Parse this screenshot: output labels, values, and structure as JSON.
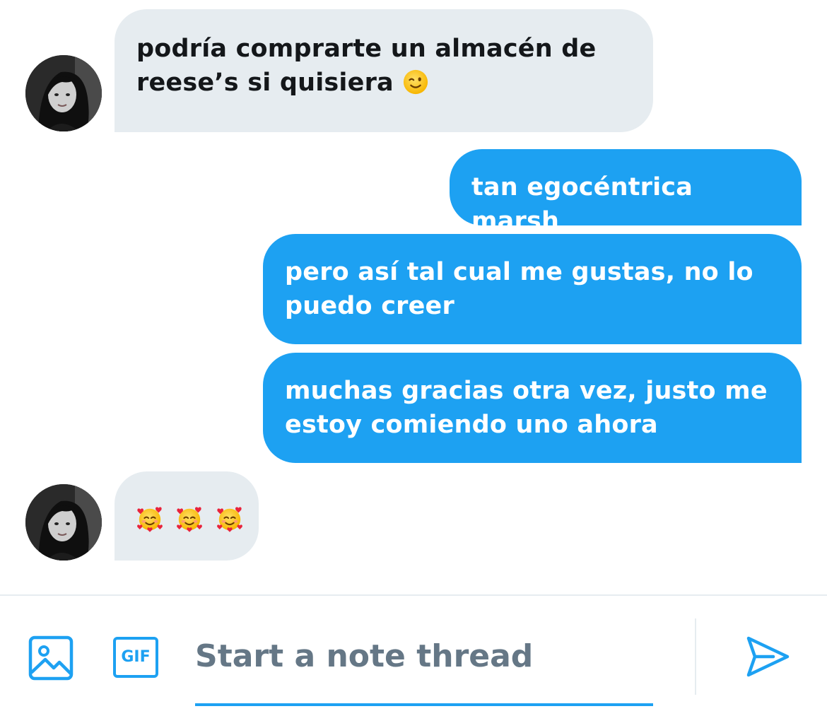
{
  "messages": [
    {
      "direction": "incoming",
      "lines": [
        "podría comprarte un almacén de",
        "reese’s si quisiera"
      ],
      "emoji": "winking-face"
    },
    {
      "direction": "outgoing",
      "lines": [
        "tan egocéntrica marsh"
      ]
    },
    {
      "direction": "outgoing",
      "lines": [
        "pero así tal cual me gustas, no lo",
        "puedo creer"
      ]
    },
    {
      "direction": "outgoing",
      "lines": [
        "muchas gracias otra vez, justo me",
        "estoy comiendo uno ahora"
      ]
    },
    {
      "direction": "incoming",
      "emojis": [
        "smiling-face-with-hearts",
        "smiling-face-with-hearts",
        "smiling-face-with-hearts"
      ]
    }
  ],
  "composer": {
    "placeholder": "Start a note thread",
    "gif_label": "GIF",
    "icons": [
      "image-icon",
      "gif-icon",
      "send-icon"
    ]
  },
  "colors": {
    "accent": "#1da1f2",
    "incoming_bubble": "#e6ecf0",
    "placeholder_text": "#657786"
  }
}
